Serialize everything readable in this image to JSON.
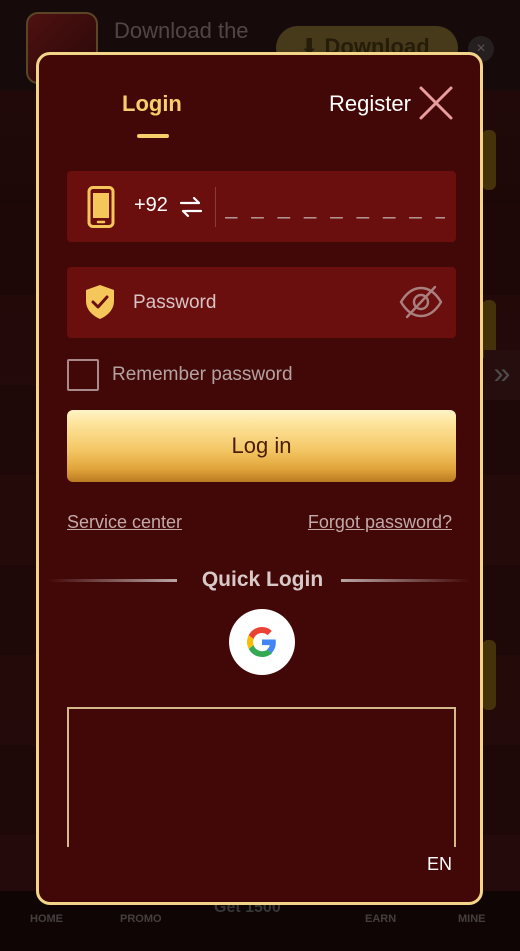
{
  "background": {
    "download_text": "Download the",
    "download_button": "Download",
    "download_close": "×",
    "nav_left": "HOME",
    "nav_promo": "PROMO",
    "nav_mid": "Get 1500",
    "nav_earn": "EARN",
    "nav_mine": "MINE",
    "arrow": "»"
  },
  "modal": {
    "tabs": [
      {
        "label": "Login",
        "active": true
      },
      {
        "label": "Register",
        "active": false
      }
    ],
    "phone": {
      "country_code": "+92",
      "placeholder": "_ _ _ _ _ _ _ _ _ _"
    },
    "password": {
      "placeholder": "Password"
    },
    "remember_label": "Remember password",
    "remember_checked": false,
    "login_button": "Log in",
    "links": {
      "service": "Service center",
      "forgot": "Forgot password?"
    },
    "quick_login_label": "Quick Login",
    "language": "EN"
  },
  "icons": {
    "close": "close-icon",
    "phone": "phone-icon",
    "swap": "swap-icon",
    "shield": "shield-check-icon",
    "eye": "eye-off-icon",
    "google": "google-icon"
  },
  "colors": {
    "modal_bg": "#420707",
    "field_bg": "#6a0e0e",
    "accent_gold": "#f5cf6c",
    "border_gold": "#f3d58a"
  }
}
